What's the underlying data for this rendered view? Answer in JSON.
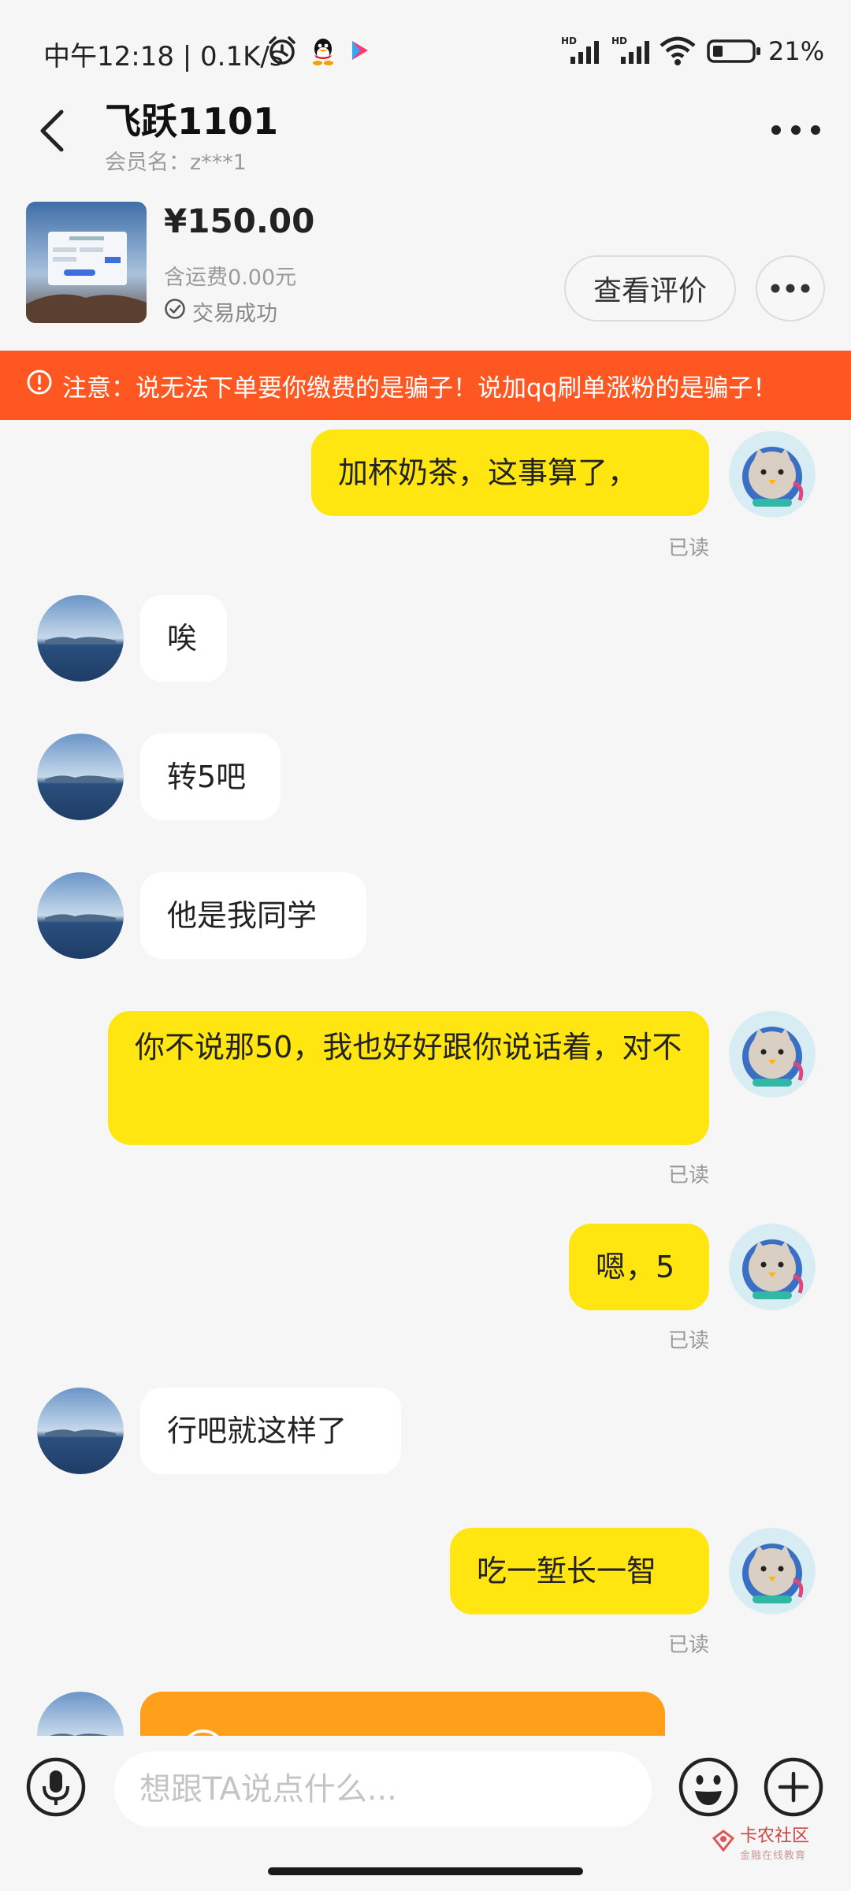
{
  "status_bar": {
    "time_speed": "中午12:18 | 0.1K/s",
    "battery": "21%"
  },
  "header": {
    "title": "飞跃1101",
    "member_name": "会员名：z***1"
  },
  "product": {
    "price": "¥150.00",
    "shipping": "含运费0.00元",
    "trade_status": "交易成功",
    "view_review_label": "查看评价"
  },
  "warning": {
    "text": "注意：说无法下单要你缴费的是骗子！说加qq刷单涨粉的是骗子！",
    "color": "#ff5722"
  },
  "messages": [
    {
      "from": "me",
      "text": "加杯奶茶，这事算了，",
      "read": "已读"
    },
    {
      "from": "them",
      "text": "唉"
    },
    {
      "from": "them",
      "text": "转5吧"
    },
    {
      "from": "them",
      "text": "他是我同学"
    },
    {
      "from": "me",
      "text": "你不说那50，我也好好跟你说话着，对不",
      "read": "已读"
    },
    {
      "from": "me",
      "text": "嗯，5",
      "read": "已读"
    },
    {
      "from": "them",
      "text": "行吧就这样了"
    },
    {
      "from": "me",
      "text": "吃一堑长一智",
      "read": "已读"
    }
  ],
  "input": {
    "placeholder": "想跟TA说点什么..."
  },
  "watermark": {
    "title": "卡农社区",
    "subtitle": "金融在线教育"
  },
  "colors": {
    "my_bubble": "#ffe611",
    "their_bubble": "#ffffff",
    "card_bubble": "#ff9f1a",
    "background": "#f6f6f6"
  }
}
